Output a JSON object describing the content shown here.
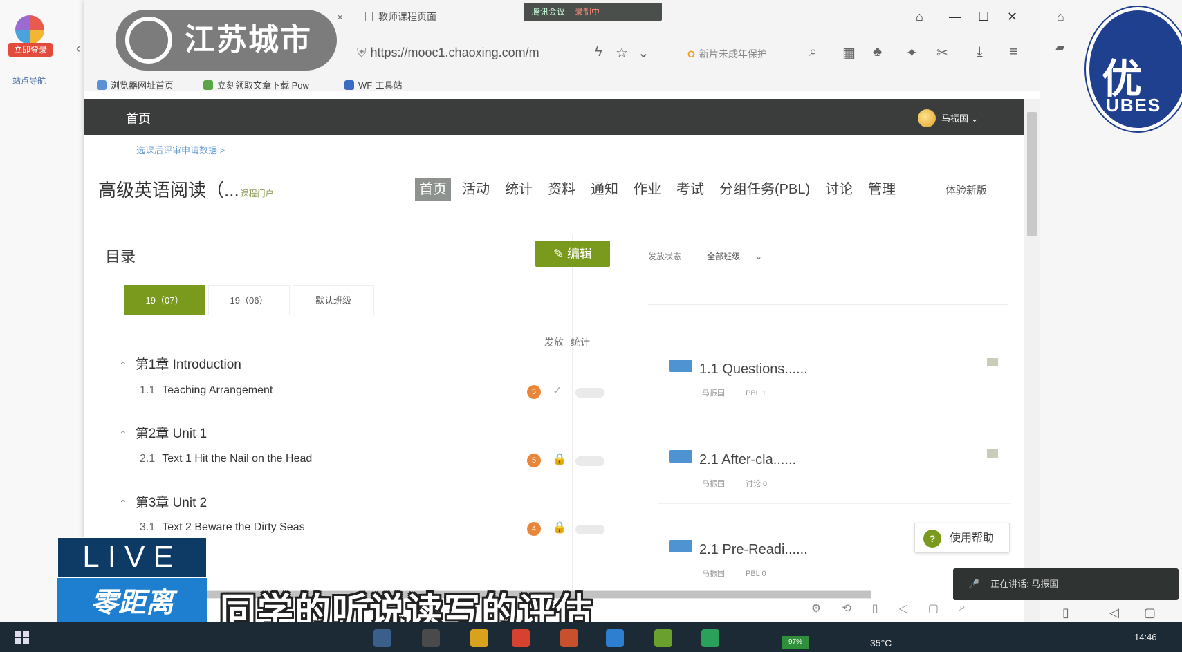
{
  "left_panel": {
    "logo_tag": "立即登录",
    "bookmark": "站点导航"
  },
  "station": {
    "name": "江苏城市"
  },
  "emblem": {
    "big_text": "优",
    "small_text": "UBES"
  },
  "browser": {
    "tab_title": "教师课程页面",
    "meeting_bar": {
      "label": "腾讯会议",
      "recording": "录制中"
    },
    "url": "https://mooc1.chaoxing.com/m",
    "search_placeholder": "新片未成年保护",
    "bookmarks": [
      "浏览器网址首页",
      "立刻领取文章下载 Pow",
      "WF-工具站"
    ]
  },
  "site": {
    "home": "首页",
    "user_name": "马振国",
    "breadcrumb": "选课后评审申请数据 >",
    "course_title": "高级英语阅读（...",
    "course_subtitle": "课程门户",
    "tabs": [
      "首页",
      "活动",
      "统计",
      "资料",
      "通知",
      "作业",
      "考试",
      "分组任务(PBL)",
      "讨论",
      "管理"
    ],
    "active_tab": "首页",
    "try_link": "体验新版"
  },
  "toc": {
    "title": "目录",
    "edit_label": "编辑",
    "semester_tabs": [
      "19（07）",
      "19（06）",
      "默认班级"
    ],
    "column_headers": [
      "发放",
      "统计"
    ],
    "chapters": [
      {
        "label": "第1章 Introduction",
        "lessons": [
          {
            "num": "1.1",
            "title": "Teaching Arrangement",
            "badge": "5",
            "state": "✓"
          }
        ]
      },
      {
        "label": "第2章 Unit 1",
        "lessons": [
          {
            "num": "2.1",
            "title": "Text 1 Hit the Nail on the Head",
            "badge": "5",
            "state": "🔒"
          }
        ]
      },
      {
        "label": "第3章 Unit 2",
        "lessons": [
          {
            "num": "3.1",
            "title": "Text 2 Beware the Dirty Seas",
            "badge": "4",
            "state": "🔒"
          }
        ]
      }
    ]
  },
  "activities": {
    "filter_label": "发放状态",
    "filter_value": "全部班级",
    "items": [
      {
        "name": "1.1 Questions......",
        "meta_a": "马振国",
        "meta_b": "PBL 1"
      },
      {
        "name": "2.1 After-cla......",
        "meta_a": "马振国",
        "meta_b": "讨论 0"
      },
      {
        "name": "2.1 Pre-Readi......",
        "meta_a": "马振国",
        "meta_b": "PBL 0"
      }
    ]
  },
  "help": {
    "icon": "?",
    "label": "使用帮助"
  },
  "speaking": {
    "text": "正在讲话: 马振国"
  },
  "broadcast": {
    "live": "LIVE",
    "program": "零距离",
    "subtitle": "同学的听说读写的评估"
  },
  "taskbar": {
    "battery": "97%",
    "temperature": "35°C",
    "clock": "14:46"
  },
  "colors": {
    "accent_green": "#7a9a1e",
    "nav_dark": "#3b3d3c",
    "live_blue": "#0d3b66",
    "badge_orange": "#e9863a"
  }
}
